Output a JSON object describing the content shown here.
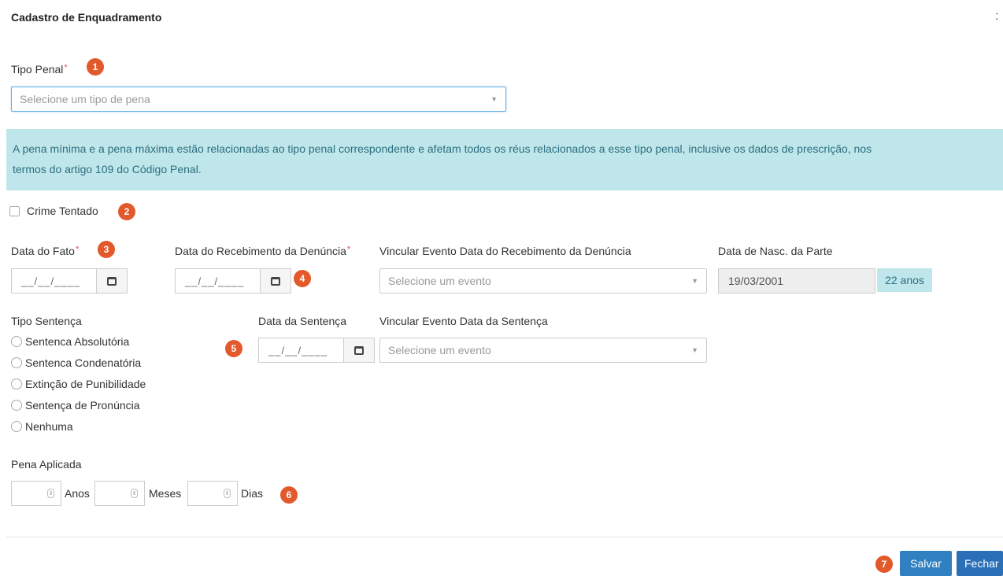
{
  "modal": {
    "title": "Cadastro de Enquadramento",
    "close_glyph": ":"
  },
  "tipo_penal": {
    "label": "Tipo Penal",
    "required": "*",
    "badge": "1",
    "placeholder": "Selecione um tipo de pena"
  },
  "info": {
    "line1": "A pena mínima e a pena máxima estão relacionadas ao tipo penal correspondente e afetam todos os réus relacionados a esse tipo penal, inclusive os dados de prescrição, nos",
    "line2": "termos do artigo 109 do Código Penal."
  },
  "crime_tentado": {
    "label": "Crime Tentado",
    "badge": "2"
  },
  "data_fato": {
    "label": "Data do Fato",
    "required": "*",
    "badge": "3",
    "mask": "__/__/____"
  },
  "data_recebimento": {
    "label": "Data do Recebimento da Denúncia",
    "required": "*",
    "badge": "4",
    "mask": "__/__/____"
  },
  "vincular_recebimento": {
    "label": "Vincular Evento Data do Recebimento da Denúncia",
    "placeholder": "Selecione um evento"
  },
  "data_nasc": {
    "label": "Data de Nasc. da Parte",
    "value": "19/03/2001",
    "age": "22 anos"
  },
  "tipo_sentenca": {
    "label": "Tipo Sentença",
    "options": [
      "Sentenca Absolutória",
      "Sentenca Condenatória",
      "Extinção de Punibilidade",
      "Sentença de Pronúncia",
      "Nenhuma"
    ]
  },
  "data_sentenca": {
    "label": "Data da Sentença",
    "badge": "5",
    "mask": "__/__/____"
  },
  "vincular_sentenca": {
    "label": "Vincular Evento Data da Sentença",
    "placeholder": "Selecione um evento"
  },
  "pena_aplicada": {
    "label": "Pena Aplicada",
    "anos": "Anos",
    "meses": "Meses",
    "dias": "Dias",
    "badge": "6"
  },
  "footer": {
    "badge": "7",
    "save_label": "Salvar",
    "close_label": "Fechar"
  },
  "colors": {
    "badge": "#e2592b",
    "info_bg": "#bfe6ea",
    "primary": "#2f7fc1"
  }
}
